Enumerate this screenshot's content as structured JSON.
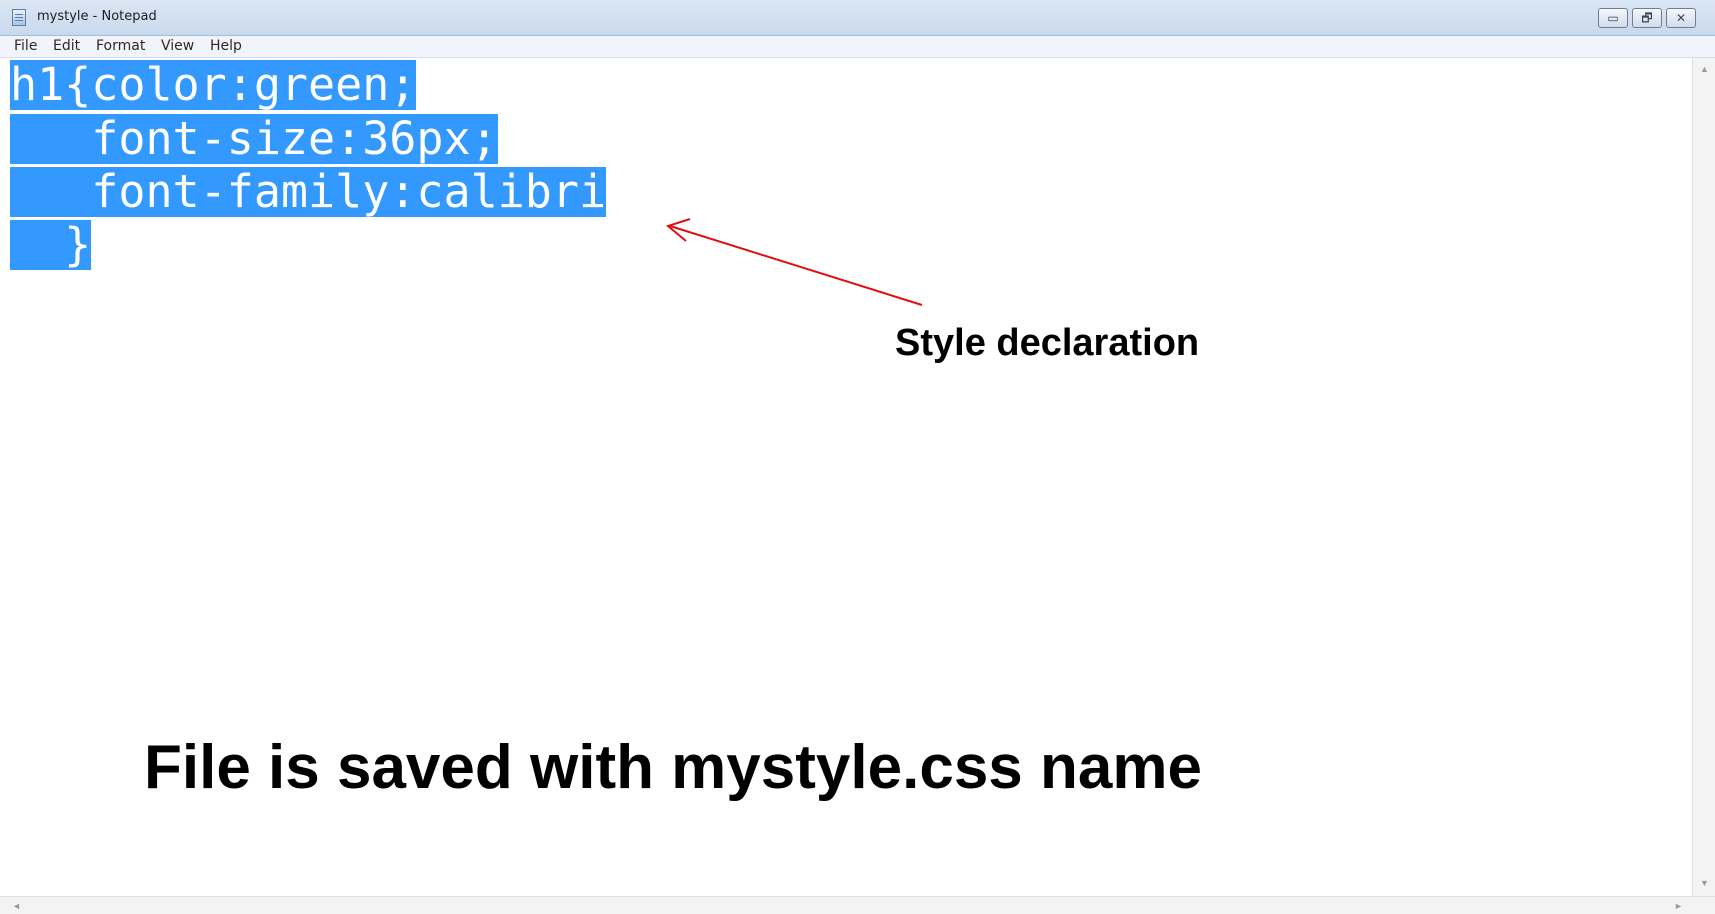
{
  "window": {
    "title": "mystyle - Notepad",
    "icon": "notepad-icon",
    "controls": {
      "minimize": "▭",
      "maximize": "🗗",
      "close": "✕"
    }
  },
  "menu": [
    "File",
    "Edit",
    "Format",
    "View",
    "Help"
  ],
  "editor": {
    "selection_color": "#3399ff",
    "lines": [
      "h1{color:green;",
      "   font-size:36px;",
      "   font-family:calibri",
      "  }"
    ]
  },
  "annotations": {
    "label": "Style declaration",
    "caption": "File is saved with mystyle.css name",
    "arrow_color": "#e01010"
  },
  "scrollbars": {
    "up": "▲",
    "down": "▼",
    "left": "◄",
    "right": "►"
  }
}
